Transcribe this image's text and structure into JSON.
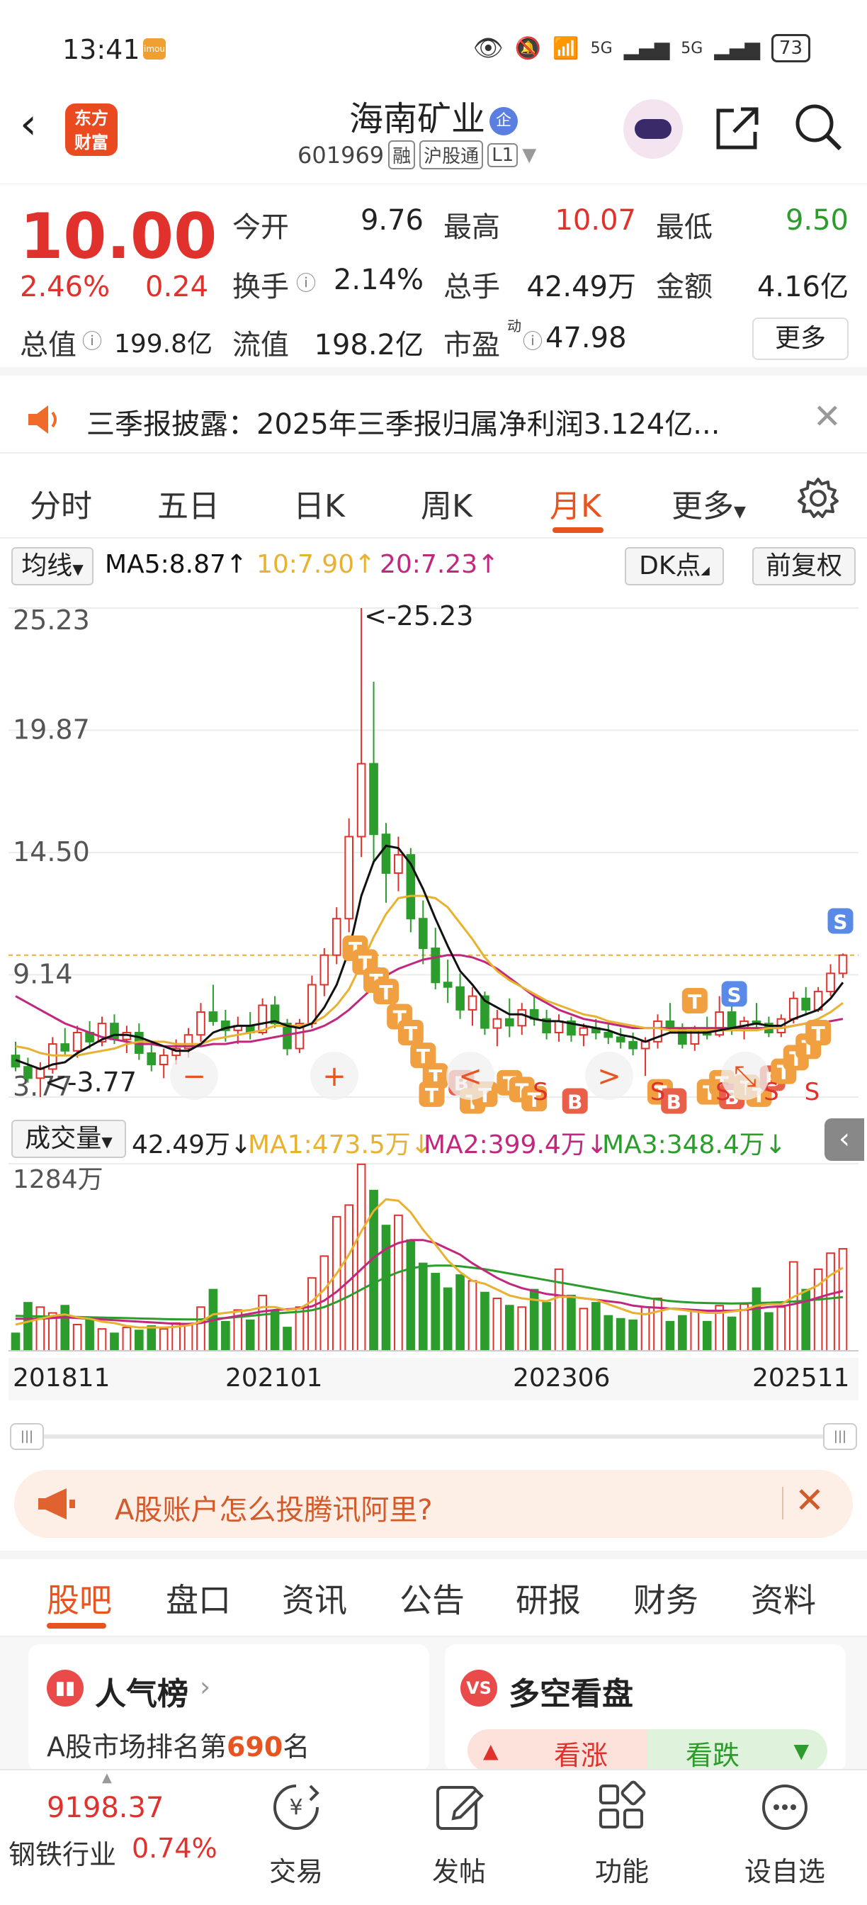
{
  "status_bar": {
    "time": "13:41",
    "app_badge": "imou",
    "signal1": "5G",
    "signal2": "5G",
    "battery": "73"
  },
  "header": {
    "logo_line1": "东方",
    "logo_line2": "财富",
    "stock_name": "海南矿业",
    "ent_badge": "企",
    "code": "601969",
    "tags": [
      "融",
      "沪股通",
      "L1"
    ]
  },
  "quote": {
    "price": "10.00",
    "change_pct": "2.46%",
    "change_amt": "0.24",
    "open_label": "今开",
    "open": "9.76",
    "high_label": "最高",
    "high": "10.07",
    "low_label": "最低",
    "low": "9.50",
    "turnover_label": "换手",
    "turnover": "2.14%",
    "volume_label": "总手",
    "volume": "42.49万",
    "amount_label": "金额",
    "amount": "4.16亿",
    "mktcap_label": "总值",
    "mktcap": "199.8亿",
    "float_label": "流值",
    "float": "198.2亿",
    "pe_label": "市盈",
    "pe_sup": "动",
    "pe": "47.98",
    "more": "更多"
  },
  "notice": {
    "text": "三季报披露：2025年三季报归属净利润3.124亿..."
  },
  "period_tabs": [
    "分时",
    "五日",
    "日K",
    "周K",
    "月K",
    "更多"
  ],
  "active_period": "月K",
  "ma_bar": {
    "select": "均线",
    "ma5": "MA5:8.87↑",
    "ma10": "10:7.90↑",
    "ma20": "20:7.23↑",
    "dk": "DK点",
    "adjust": "前复权"
  },
  "chart_data": {
    "type": "candlestick",
    "title": "",
    "y_ticks": [
      "25.23",
      "19.87",
      "14.50",
      "9.14",
      "3.77"
    ],
    "ylim": [
      3.77,
      25.23
    ],
    "annotations": {
      "max": "<-25.23",
      "min": "<-3.77"
    },
    "series": [
      {
        "name": "MA5",
        "color": "#111111"
      },
      {
        "name": "10",
        "color": "#e8b230"
      },
      {
        "name": "20",
        "color": "#c2277f"
      }
    ],
    "ohlc": [
      [
        5.6,
        6.2,
        4.9,
        5.1
      ],
      [
        5.1,
        5.5,
        4.4,
        4.6
      ],
      [
        4.6,
        5.3,
        3.77,
        5.0
      ],
      [
        5.0,
        6.4,
        4.8,
        6.1
      ],
      [
        6.1,
        6.8,
        5.6,
        5.8
      ],
      [
        5.8,
        6.9,
        5.5,
        6.6
      ],
      [
        6.6,
        7.1,
        5.9,
        6.2
      ],
      [
        6.2,
        7.3,
        6.0,
        7.0
      ],
      [
        7.0,
        7.4,
        6.1,
        6.3
      ],
      [
        6.3,
        6.9,
        5.7,
        6.6
      ],
      [
        6.6,
        7.0,
        5.4,
        5.7
      ],
      [
        5.7,
        6.2,
        4.9,
        5.2
      ],
      [
        5.2,
        5.9,
        4.6,
        5.6
      ],
      [
        5.6,
        6.3,
        5.2,
        5.9
      ],
      [
        5.9,
        6.8,
        5.5,
        6.5
      ],
      [
        6.5,
        7.9,
        6.2,
        7.5
      ],
      [
        7.5,
        8.7,
        6.9,
        7.1
      ],
      [
        7.1,
        7.6,
        6.2,
        6.7
      ],
      [
        6.7,
        7.3,
        6.1,
        6.9
      ],
      [
        6.9,
        7.5,
        6.3,
        6.6
      ],
      [
        6.6,
        8.1,
        6.5,
        7.8
      ],
      [
        7.8,
        8.2,
        6.8,
        7.0
      ],
      [
        7.0,
        7.2,
        5.6,
        5.9
      ],
      [
        5.9,
        7.2,
        5.7,
        7.0
      ],
      [
        7.0,
        9.1,
        6.8,
        8.7
      ],
      [
        8.7,
        10.3,
        8.2,
        10.0
      ],
      [
        10.0,
        12.1,
        9.6,
        11.6
      ],
      [
        11.6,
        16.0,
        11.0,
        15.2
      ],
      [
        15.2,
        25.23,
        14.3,
        18.4
      ],
      [
        18.4,
        22.0,
        14.0,
        15.3
      ],
      [
        15.3,
        15.8,
        12.3,
        13.6
      ],
      [
        13.6,
        15.2,
        12.8,
        14.4
      ],
      [
        14.4,
        14.7,
        11.0,
        11.6
      ],
      [
        11.6,
        12.4,
        9.6,
        10.3
      ],
      [
        10.3,
        11.2,
        8.5,
        8.8
      ],
      [
        8.8,
        9.8,
        7.9,
        8.6
      ],
      [
        8.6,
        9.2,
        7.2,
        7.6
      ],
      [
        7.6,
        8.6,
        6.9,
        8.2
      ],
      [
        8.2,
        8.4,
        6.5,
        6.8
      ],
      [
        6.8,
        7.6,
        6.0,
        7.2
      ],
      [
        7.2,
        8.1,
        6.4,
        6.9
      ],
      [
        6.9,
        7.9,
        6.5,
        7.6
      ],
      [
        7.6,
        8.3,
        6.9,
        7.2
      ],
      [
        7.2,
        7.6,
        6.3,
        6.6
      ],
      [
        6.6,
        7.4,
        6.2,
        7.1
      ],
      [
        7.1,
        7.3,
        6.2,
        6.5
      ],
      [
        6.5,
        7.0,
        6.0,
        6.8
      ],
      [
        6.8,
        7.2,
        6.3,
        6.6
      ],
      [
        6.6,
        7.0,
        6.1,
        6.4
      ],
      [
        6.4,
        6.8,
        5.9,
        6.2
      ],
      [
        6.2,
        6.6,
        5.6,
        5.9
      ],
      [
        5.9,
        6.4,
        4.7,
        6.2
      ],
      [
        6.2,
        7.4,
        5.9,
        7.1
      ],
      [
        7.1,
        7.9,
        6.6,
        6.8
      ],
      [
        6.8,
        7.0,
        5.9,
        6.1
      ],
      [
        6.1,
        6.9,
        5.8,
        6.7
      ],
      [
        6.7,
        7.3,
        6.3,
        6.5
      ],
      [
        6.5,
        8.2,
        6.4,
        7.5
      ],
      [
        7.5,
        7.8,
        6.5,
        6.8
      ],
      [
        6.8,
        7.3,
        6.3,
        7.1
      ],
      [
        7.1,
        7.9,
        6.8,
        7.0
      ],
      [
        7.0,
        7.3,
        6.4,
        6.6
      ],
      [
        6.6,
        7.4,
        6.4,
        7.2
      ],
      [
        7.2,
        8.4,
        7.0,
        8.1
      ],
      [
        8.1,
        8.6,
        7.4,
        7.6
      ],
      [
        7.6,
        8.6,
        7.5,
        8.4
      ],
      [
        8.4,
        9.6,
        8.2,
        9.2
      ],
      [
        9.2,
        10.07,
        9.0,
        10.0
      ]
    ],
    "ma5": [
      5.4,
      5.2,
      5.0,
      5.2,
      5.3,
      5.7,
      6.0,
      6.3,
      6.5,
      6.5,
      6.4,
      6.2,
      6.0,
      5.8,
      5.8,
      6.1,
      6.6,
      6.8,
      6.9,
      6.9,
      7.0,
      7.1,
      6.9,
      6.8,
      7.0,
      7.7,
      8.7,
      10.2,
      12.6,
      14.1,
      14.8,
      14.7,
      14.0,
      12.9,
      11.6,
      10.4,
      9.3,
      8.7,
      8.0,
      7.7,
      7.4,
      7.4,
      7.2,
      7.1,
      7.1,
      7.0,
      6.9,
      6.8,
      6.7,
      6.5,
      6.4,
      6.2,
      6.4,
      6.6,
      6.6,
      6.6,
      6.6,
      6.7,
      6.8,
      6.9,
      7.0,
      6.9,
      6.9,
      7.2,
      7.4,
      7.6,
      8.1,
      8.8
    ],
    "ma10": [
      6.0,
      5.9,
      5.7,
      5.6,
      5.6,
      5.6,
      5.7,
      5.8,
      5.9,
      6.1,
      6.2,
      6.2,
      6.2,
      6.1,
      6.1,
      6.1,
      6.3,
      6.4,
      6.5,
      6.6,
      6.7,
      6.9,
      6.9,
      6.9,
      7.0,
      7.3,
      7.8,
      8.5,
      9.6,
      10.8,
      11.8,
      12.5,
      12.6,
      12.6,
      12.5,
      12.1,
      11.4,
      10.7,
      9.9,
      9.3,
      8.9,
      8.6,
      8.3,
      8.0,
      7.8,
      7.6,
      7.4,
      7.3,
      7.1,
      7.0,
      6.9,
      6.8,
      6.8,
      6.7,
      6.7,
      6.7,
      6.7,
      6.7,
      6.7,
      6.7,
      6.7,
      6.8,
      6.8,
      6.9,
      7.0,
      7.2,
      7.5,
      7.9
    ],
    "ma20": [
      8.2,
      7.9,
      7.6,
      7.3,
      7.0,
      6.8,
      6.6,
      6.4,
      6.3,
      6.2,
      6.1,
      6.1,
      6.0,
      6.0,
      6.0,
      6.0,
      6.1,
      6.1,
      6.2,
      6.2,
      6.3,
      6.4,
      6.5,
      6.6,
      6.7,
      6.9,
      7.2,
      7.6,
      8.1,
      8.6,
      9.1,
      9.4,
      9.6,
      9.8,
      9.9,
      10.0,
      10.0,
      9.9,
      9.7,
      9.4,
      9.0,
      8.6,
      8.2,
      7.9,
      7.6,
      7.4,
      7.2,
      7.1,
      7.0,
      6.9,
      6.8,
      6.8,
      6.8,
      6.8,
      6.8,
      6.8,
      6.8,
      6.8,
      6.8,
      6.8,
      6.8,
      6.8,
      6.8,
      6.9,
      7.0,
      7.0,
      7.1,
      7.2
    ],
    "x_ticks": [
      "201811",
      "202101",
      "202306",
      "202511"
    ]
  },
  "chart_overlay": {
    "zoom_in": "+",
    "zoom_out": "−",
    "prev": "<",
    "next": ">",
    "expand": "⤡"
  },
  "signals": [
    {
      "t": "T",
      "x": 27.5,
      "y": 10.3
    },
    {
      "t": "T",
      "x": 28.3,
      "y": 9.7
    },
    {
      "t": "T",
      "x": 29.2,
      "y": 8.9
    },
    {
      "t": "T",
      "x": 30.0,
      "y": 8.4
    },
    {
      "t": "T",
      "x": 31.1,
      "y": 7.3
    },
    {
      "t": "T",
      "x": 32.0,
      "y": 6.6
    },
    {
      "t": "T",
      "x": 33.0,
      "y": 5.6
    },
    {
      "t": "T",
      "x": 34.0,
      "y": 4.7
    },
    {
      "t": "B",
      "x": 36.1,
      "y": 4.4
    },
    {
      "t": "T",
      "x": 33.7,
      "y": 3.9
    },
    {
      "t": "T",
      "x": 37.0,
      "y": 3.6
    },
    {
      "t": "T",
      "x": 38.0,
      "y": 3.9
    },
    {
      "t": "T",
      "x": 40.0,
      "y": 4.4
    },
    {
      "t": "T",
      "x": 41.0,
      "y": 4.1
    },
    {
      "t": "T",
      "x": 42.0,
      "y": 3.7
    },
    {
      "t": "B",
      "x": 45.3,
      "y": 3.6
    },
    {
      "t": "T",
      "x": 52.2,
      "y": 4.0
    },
    {
      "t": "B",
      "x": 53.3,
      "y": 3.6
    },
    {
      "t": "T",
      "x": 55.0,
      "y": 8.0
    },
    {
      "t": "S",
      "x": 58.2,
      "y": 8.3
    },
    {
      "t": "T",
      "x": 56.2,
      "y": 4.0
    },
    {
      "t": "T",
      "x": 57.2,
      "y": 4.4
    },
    {
      "t": "B",
      "x": 58.0,
      "y": 3.8
    },
    {
      "t": "T",
      "x": 59.2,
      "y": 4.2
    },
    {
      "t": "T",
      "x": 60.2,
      "y": 3.9
    },
    {
      "t": "B",
      "x": 61.3,
      "y": 4.6
    },
    {
      "t": "T",
      "x": 62.2,
      "y": 4.9
    },
    {
      "t": "T",
      "x": 63.2,
      "y": 5.5
    },
    {
      "t": "T",
      "x": 64.2,
      "y": 6.0
    },
    {
      "t": "T",
      "x": 65.0,
      "y": 6.6
    },
    {
      "t": "S",
      "x": 66.8,
      "y": 11.5
    }
  ],
  "sell_marks": [
    {
      "t": "S",
      "x": 42.5
    },
    {
      "t": "S",
      "x": 52.0
    },
    {
      "t": "S",
      "x": 57.3
    },
    {
      "t": "S",
      "x": 61.2
    },
    {
      "t": "S",
      "x": 64.5
    }
  ],
  "vol_bar": {
    "select": "成交量",
    "current": "42.49万↓",
    "ma1": "MA1:473.5万↓",
    "ma2": "MA2:399.4万↓",
    "ma3": "MA3:348.4万↓"
  },
  "vol_data": {
    "ymax_label": "1284万",
    "ymax": 1284,
    "values": [
      120,
      330,
      300,
      260,
      310,
      180,
      220,
      150,
      120,
      160,
      140,
      170,
      150,
      190,
      180,
      300,
      420,
      200,
      280,
      210,
      380,
      270,
      160,
      300,
      500,
      650,
      920,
      1000,
      1280,
      1100,
      860,
      930,
      760,
      600,
      530,
      430,
      520,
      480,
      400,
      360,
      310,
      300,
      420,
      330,
      560,
      380,
      290,
      330,
      240,
      220,
      210,
      300,
      360,
      200,
      240,
      280,
      200,
      310,
      230,
      320,
      430,
      260,
      300,
      610,
      420,
      560,
      670,
      700
    ],
    "ma1": [
      180,
      200,
      220,
      240,
      250,
      230,
      220,
      200,
      190,
      170,
      160,
      160,
      160,
      165,
      175,
      200,
      250,
      260,
      270,
      280,
      300,
      300,
      280,
      290,
      340,
      420,
      530,
      660,
      820,
      960,
      1040,
      1030,
      950,
      830,
      730,
      620,
      540,
      480,
      460,
      420,
      380,
      360,
      350,
      340,
      370,
      370,
      360,
      350,
      320,
      290,
      260,
      250,
      270,
      290,
      280,
      270,
      260,
      260,
      270,
      280,
      310,
      320,
      320,
      370,
      410,
      450,
      520,
      570
    ],
    "ma2": [
      220,
      220,
      220,
      225,
      230,
      225,
      220,
      215,
      210,
      205,
      200,
      195,
      190,
      185,
      185,
      190,
      210,
      225,
      240,
      255,
      270,
      280,
      285,
      290,
      305,
      345,
      405,
      480,
      560,
      640,
      700,
      740,
      760,
      760,
      740,
      700,
      660,
      600,
      550,
      500,
      460,
      430,
      410,
      390,
      380,
      370,
      360,
      350,
      340,
      330,
      310,
      300,
      295,
      290,
      285,
      280,
      275,
      275,
      275,
      280,
      290,
      300,
      305,
      320,
      340,
      365,
      390,
      410
    ],
    "ma3": [
      240,
      238,
      236,
      235,
      234,
      232,
      230,
      228,
      226,
      224,
      222,
      220,
      218,
      216,
      215,
      216,
      220,
      225,
      232,
      240,
      248,
      256,
      262,
      268,
      278,
      300,
      335,
      375,
      420,
      465,
      505,
      540,
      565,
      580,
      585,
      585,
      580,
      570,
      560,
      545,
      530,
      515,
      500,
      485,
      470,
      455,
      440,
      425,
      410,
      395,
      380,
      365,
      352,
      342,
      335,
      330,
      328,
      326,
      325,
      326,
      328,
      330,
      333,
      338,
      345,
      352,
      360,
      368
    ]
  },
  "promo": {
    "text": "A股账户怎么投腾讯阿里?"
  },
  "sub_tabs": [
    "股吧",
    "盘口",
    "资讯",
    "公告",
    "研报",
    "财务",
    "资料"
  ],
  "active_sub_tab": "股吧",
  "card_left": {
    "title": "人气榜",
    "rank_prefix": "A股市场排名第",
    "rank": "690",
    "rank_suffix": "名"
  },
  "card_right": {
    "title": "多空看盘",
    "bull": "看涨",
    "bear": "看跌"
  },
  "bottom": {
    "index_value": "9198.37",
    "index_name": "钢铁行业",
    "index_chg": "0.74%",
    "nav": [
      "交易",
      "发帖",
      "功能",
      "设自选"
    ]
  },
  "colors": {
    "up": "#e0312d",
    "down": "#2c9c2c",
    "accent": "#e8541f",
    "signal_t": "#f0a040",
    "signal_b": "#e8604a",
    "signal_s": "#5a8ae8"
  }
}
